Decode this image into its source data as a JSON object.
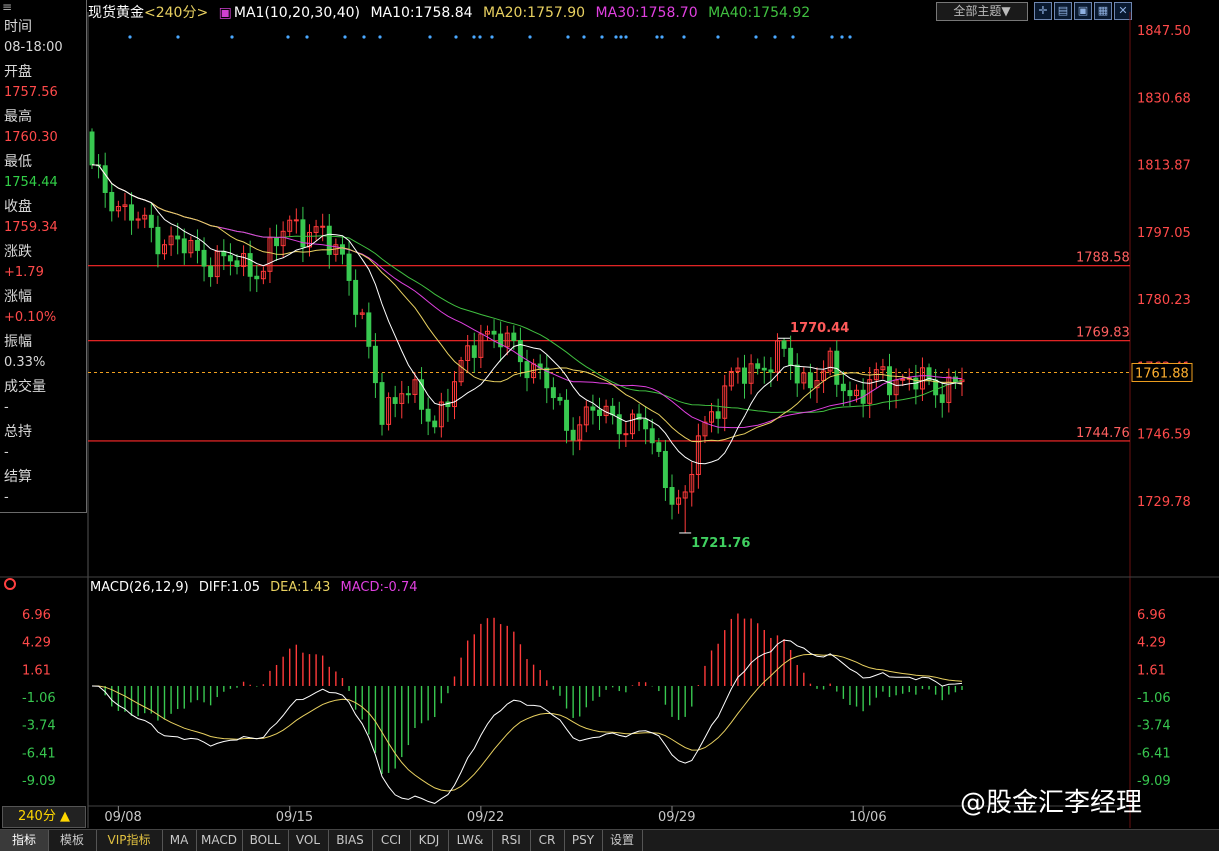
{
  "corner_glyph": "≡",
  "info_panel": {
    "rows": [
      {
        "label": "时间",
        "value": "08-18:00",
        "color": "#d8d8d8"
      },
      {
        "label": "开盘",
        "value": "1757.56",
        "color": "#ff4a4a"
      },
      {
        "label": "最高",
        "value": "1760.30",
        "color": "#ff4a4a"
      },
      {
        "label": "最低",
        "value": "1754.44",
        "color": "#32d048"
      },
      {
        "label": "收盘",
        "value": "1759.34",
        "color": "#ff4a4a"
      },
      {
        "label": "涨跌",
        "value": "+1.79",
        "color": "#ff4a4a"
      },
      {
        "label": "涨幅",
        "value": "+0.10%",
        "color": "#ff4a4a"
      },
      {
        "label": "振幅",
        "value": "0.33%",
        "color": "#d8d8d8"
      },
      {
        "label": "成交量",
        "value": "-",
        "color": "#d8d8d8"
      },
      {
        "label": "总持",
        "value": "-",
        "color": "#d8d8d8"
      },
      {
        "label": "结算",
        "value": "-",
        "color": "#d8d8d8"
      }
    ]
  },
  "header": {
    "symbol": "现货黄金",
    "period": "<240分>",
    "ma_label": "MA1(10,20,30,40)",
    "ma10": "MA10:1758.84",
    "ma20": "MA20:1757.90",
    "ma30": "MA30:1758.70",
    "ma40": "MA40:1754.92"
  },
  "controls": {
    "theme": "全部主题▼",
    "buttons": [
      "✛",
      "▤",
      "▣",
      "▦",
      "✕"
    ]
  },
  "macd_header": {
    "label": "MACD(26,12,9)",
    "diff": "DIFF:1.05",
    "dea": "DEA:1.43",
    "macd": "MACD:-0.74"
  },
  "period_button": "240分 ▲",
  "watermark": "@股金汇李经理",
  "tabs": [
    {
      "label": "指标",
      "active": true
    },
    {
      "label": "模板"
    },
    {
      "label": "VIP指标",
      "vip": true
    },
    {
      "label": "MA"
    },
    {
      "label": "MACD"
    },
    {
      "label": "BOLL"
    },
    {
      "label": "VOL"
    },
    {
      "label": "BIAS"
    },
    {
      "label": "CCI"
    },
    {
      "label": "KDJ"
    },
    {
      "label": "LW&"
    },
    {
      "label": "RSI"
    },
    {
      "label": "CR"
    },
    {
      "label": "PSY"
    },
    {
      "label": "设置"
    }
  ],
  "colors": {
    "up": "#ff3a3a",
    "down": "#38c850",
    "ma10": "#ffffff",
    "ma20": "#e8d060",
    "ma30": "#e040e0",
    "ma40": "#40c040",
    "price_axis": "#ff4a4a",
    "level_line": "#ff2a2a",
    "current": "#f0a020",
    "dots": "#4aa8ff"
  },
  "chart_data": [
    {
      "type": "candlestick",
      "title": "现货黄金 240分",
      "y_ticks": [
        "1847.50",
        "1830.68",
        "1813.87",
        "1797.05",
        "1780.23",
        "1763.41",
        "1746.59",
        "1729.78"
      ],
      "ylim": [
        1712,
        1852
      ],
      "x_ticks": [
        {
          "label": "09/08",
          "i": 4
        },
        {
          "label": "09/15",
          "i": 30
        },
        {
          "label": "09/22",
          "i": 59
        },
        {
          "label": "09/29",
          "i": 88
        },
        {
          "label": "10/06",
          "i": 117
        }
      ],
      "current_price": "1761.88",
      "current_value": 1761.88,
      "levels": [
        {
          "label": "1788.58",
          "value": 1788.58
        },
        {
          "label": "1769.83",
          "value": 1769.83
        },
        {
          "label": "1744.76",
          "value": 1744.76
        }
      ],
      "annotations": [
        {
          "label": "1770.44",
          "value": 1770.44,
          "i": 105
        },
        {
          "label": "1721.76",
          "value": 1721.76,
          "i": 90
        }
      ],
      "candles": [],
      "ma10": [],
      "ma20": [],
      "ma30": [],
      "ma40": []
    },
    {
      "type": "bar",
      "title": "MACD(26,12,9)",
      "y_ticks": [
        "6.96",
        "4.29",
        "1.61",
        "-1.06",
        "-3.74",
        "-6.41",
        "-9.09"
      ],
      "ylim": [
        -11.5,
        8.5
      ],
      "diff": [],
      "dea": [],
      "hist": []
    }
  ]
}
